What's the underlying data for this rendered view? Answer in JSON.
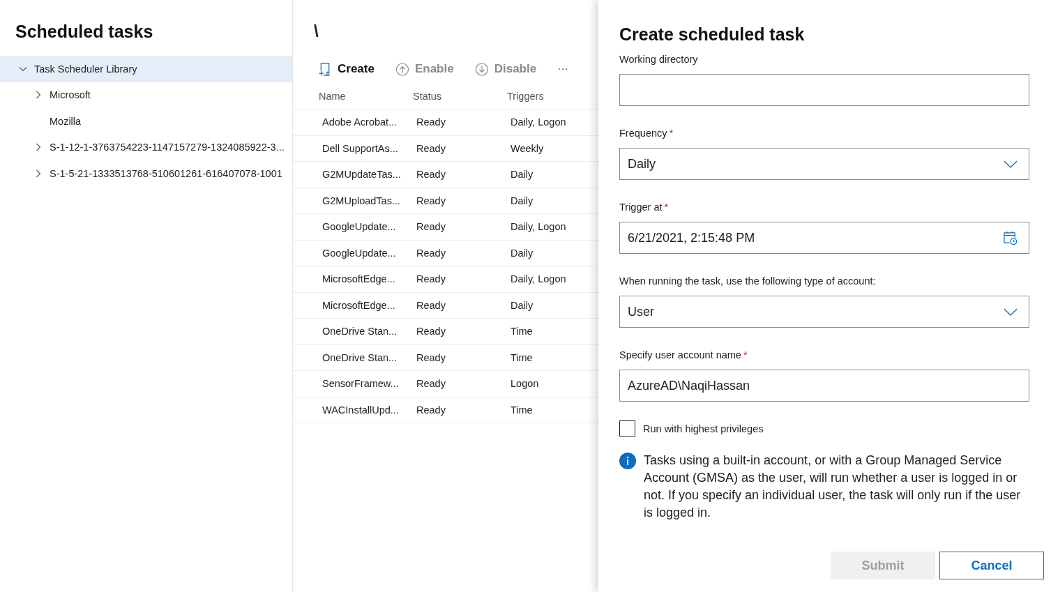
{
  "left": {
    "title": "Scheduled tasks",
    "tree": [
      {
        "label": "Task Scheduler Library",
        "has_children": true,
        "expanded": true,
        "selected": true,
        "children": [
          {
            "label": "Microsoft",
            "has_children": true,
            "expanded": false,
            "selected": false
          },
          {
            "label": "Mozilla",
            "has_children": false,
            "selected": false
          },
          {
            "label": "S-1-12-1-3763754223-1147157279-1324085922-3...",
            "has_children": true,
            "expanded": false,
            "selected": false
          },
          {
            "label": "S-1-5-21-1333513768-510601261-616407078-1001",
            "has_children": true,
            "expanded": false,
            "selected": false
          }
        ]
      }
    ]
  },
  "middle": {
    "path": "\\",
    "toolbar": [
      {
        "kind": "create",
        "label": "Create",
        "disabled": false
      },
      {
        "kind": "enable",
        "label": "Enable",
        "disabled": true
      },
      {
        "kind": "disable",
        "label": "Disable",
        "disabled": true
      }
    ],
    "more": "···",
    "columns": [
      "Name",
      "Status",
      "Triggers"
    ],
    "rows": [
      [
        "Adobe Acrobat...",
        "Ready",
        "Daily, Logon"
      ],
      [
        "Dell SupportAs...",
        "Ready",
        "Weekly"
      ],
      [
        "G2MUpdateTas...",
        "Ready",
        "Daily"
      ],
      [
        "G2MUploadTas...",
        "Ready",
        "Daily"
      ],
      [
        "GoogleUpdate...",
        "Ready",
        "Daily, Logon"
      ],
      [
        "GoogleUpdate...",
        "Ready",
        "Daily"
      ],
      [
        "MicrosoftEdge...",
        "Ready",
        "Daily, Logon"
      ],
      [
        "MicrosoftEdge...",
        "Ready",
        "Daily"
      ],
      [
        "OneDrive Stan...",
        "Ready",
        "Time"
      ],
      [
        "OneDrive Stan...",
        "Ready",
        "Time"
      ],
      [
        "SensorFramew...",
        "Ready",
        "Logon"
      ],
      [
        "WACInstallUpd...",
        "Ready",
        "Time"
      ]
    ]
  },
  "panel": {
    "title": "Create scheduled task",
    "fields": [
      {
        "kind": "text",
        "label": "Working directory"
      },
      {
        "kind": "dropdown",
        "label": "Frequency",
        "required_mark": "*",
        "value": "Daily"
      },
      {
        "kind": "date",
        "label": "Trigger at",
        "required_mark": "*",
        "value": "6/21/2021, 2:15:48 PM"
      },
      {
        "kind": "dropdown",
        "label": "When running the task, use the following type of account:",
        "value": "User"
      },
      {
        "kind": "text",
        "label": "Specify user account name",
        "required_mark": "*",
        "value": "AzureAD\\NaqiHassan"
      }
    ],
    "checkbox": {
      "label": "Run with highest privileges",
      "checked": false
    },
    "info": "Tasks using a built-in account, or with a Group Managed Service Account (GMSA) as the user, will run whether a user is logged in or not. If you specify an individual user, the task will only run if the user is logged in.",
    "buttons": [
      {
        "label": "Submit",
        "kind": "primary",
        "disabled": true
      },
      {
        "label": "Cancel",
        "kind": "secondary",
        "disabled": false
      }
    ]
  }
}
